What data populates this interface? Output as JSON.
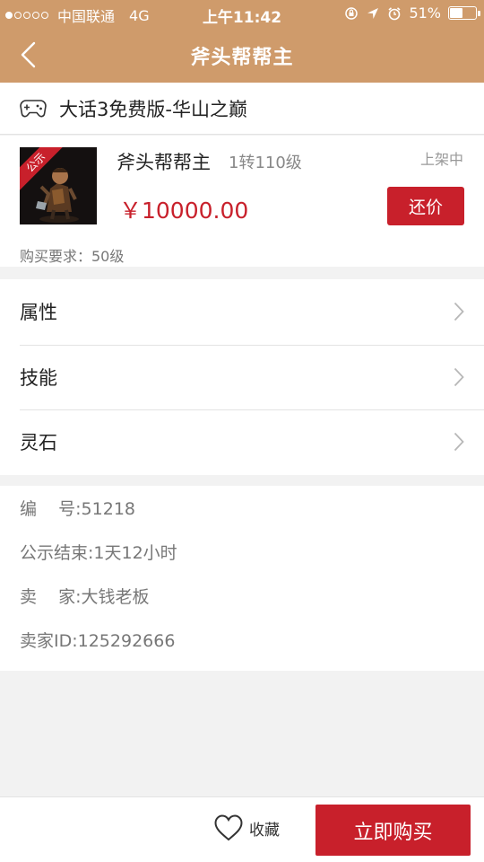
{
  "status_bar": {
    "carrier": "中国联通",
    "network": "4G",
    "time": "上午11:42",
    "battery": "51%",
    "battery_level": 0.51,
    "signal_bars_filled": 1,
    "signal_bars_total": 5
  },
  "nav": {
    "title": "斧头帮帮主",
    "back_icon": "chevron-left-icon"
  },
  "server": {
    "icon": "gamepad-icon",
    "name": "大话3免费版-华山之巅"
  },
  "product": {
    "badge": "公示",
    "name": "斧头帮帮主",
    "level": "1转110级",
    "status": "上架中",
    "price": "￥10000.00",
    "offer_button": "还价",
    "requirement": "购买要求：50级"
  },
  "menu": [
    {
      "label": "属性"
    },
    {
      "label": "技能"
    },
    {
      "label": "灵石"
    }
  ],
  "info": {
    "number": "编    号:51218",
    "publicity_end": "公示结束:1天12小时",
    "seller": "卖    家:大钱老板",
    "seller_id": "卖家ID:125292666"
  },
  "bottom": {
    "favorite_label": "收藏",
    "buy_button": "立即购买"
  },
  "colors": {
    "header": "#cf9b6b",
    "accent_red": "#c8202b",
    "background": "#f2f2f2"
  }
}
